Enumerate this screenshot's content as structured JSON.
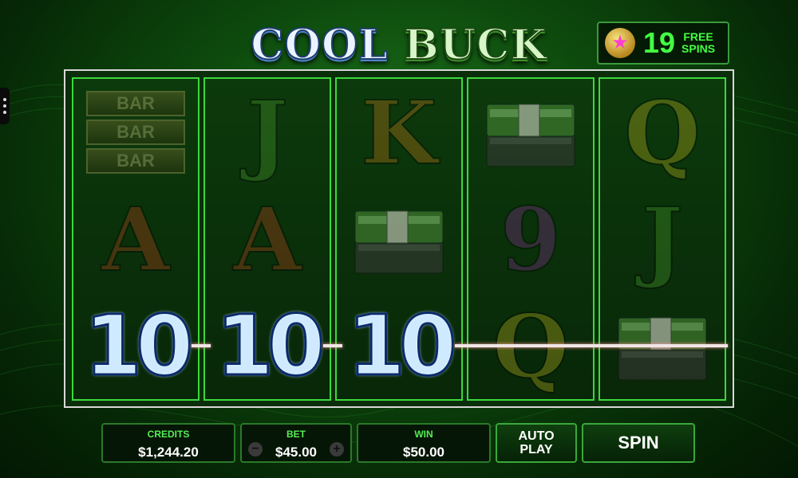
{
  "logo": {
    "word1": "COOL",
    "word2": "BUCK"
  },
  "free_spins": {
    "count": "19",
    "line1": "FREE",
    "line2": "SPINS",
    "icon": "star-icon"
  },
  "reels": [
    [
      "BAR-stack",
      "A",
      "10"
    ],
    [
      "J",
      "A",
      "10"
    ],
    [
      "K",
      "cash-stack",
      "10"
    ],
    [
      "cash-stack",
      "9",
      "Q"
    ],
    [
      "Q",
      "J",
      "cash-stack"
    ]
  ],
  "bar_labels": [
    "BAR",
    "BAR",
    "BAR"
  ],
  "symbol_text": {
    "A": "A",
    "J": "J",
    "K": "K",
    "Q": "Q",
    "nine": "9",
    "ten": "10"
  },
  "colors": {
    "A": "#c0401a",
    "J": "#4fa02f",
    "K": "#d07a1a",
    "Q": "#c8b820",
    "nine": "#8a2a9a"
  },
  "footer": {
    "credits": {
      "label": "CREDITS",
      "value": "$1,244.20"
    },
    "bet": {
      "label": "BET",
      "value": "$45.00",
      "minus": "−",
      "plus": "+"
    },
    "win": {
      "label": "WIN",
      "value": "$50.00"
    },
    "autoplay": {
      "line1": "AUTO",
      "line2": "PLAY"
    },
    "spin": {
      "label": "SPIN"
    }
  }
}
